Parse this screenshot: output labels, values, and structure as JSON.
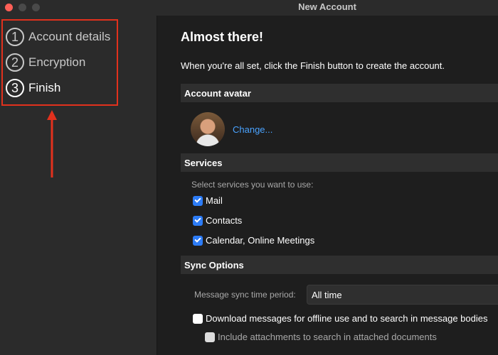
{
  "window": {
    "title": "New Account"
  },
  "sidebar": {
    "steps": [
      {
        "number": "1",
        "label": "Account details",
        "active": false
      },
      {
        "number": "2",
        "label": "Encryption",
        "active": false
      },
      {
        "number": "3",
        "label": "Finish",
        "active": true
      }
    ]
  },
  "main": {
    "heading": "Almost there!",
    "intro": "When you're all set, click the Finish button to create the account.",
    "avatar_section": {
      "title": "Account avatar",
      "change_link": "Change..."
    },
    "services_section": {
      "title": "Services",
      "prompt": "Select services you want to use:",
      "items": [
        {
          "label": "Mail",
          "checked": true
        },
        {
          "label": "Contacts",
          "checked": true
        },
        {
          "label": "Calendar, Online Meetings",
          "checked": true
        }
      ]
    },
    "sync_section": {
      "title": "Sync Options",
      "period_label": "Message sync time period:",
      "period_value": "All time",
      "download_label": "Download messages for offline use and to search in message bodies",
      "download_checked": false,
      "attachments_label": "Include attachments to search in attached documents",
      "attachments_checked": false
    }
  },
  "colors": {
    "highlight_box": "#e2311d",
    "arrow": "#e2311d",
    "link": "#4aa3ff",
    "checkbox_on": "#2d7cf6"
  },
  "icons": [
    "close-light",
    "minimize-light",
    "maximize-light",
    "up-arrow-annotation"
  ]
}
